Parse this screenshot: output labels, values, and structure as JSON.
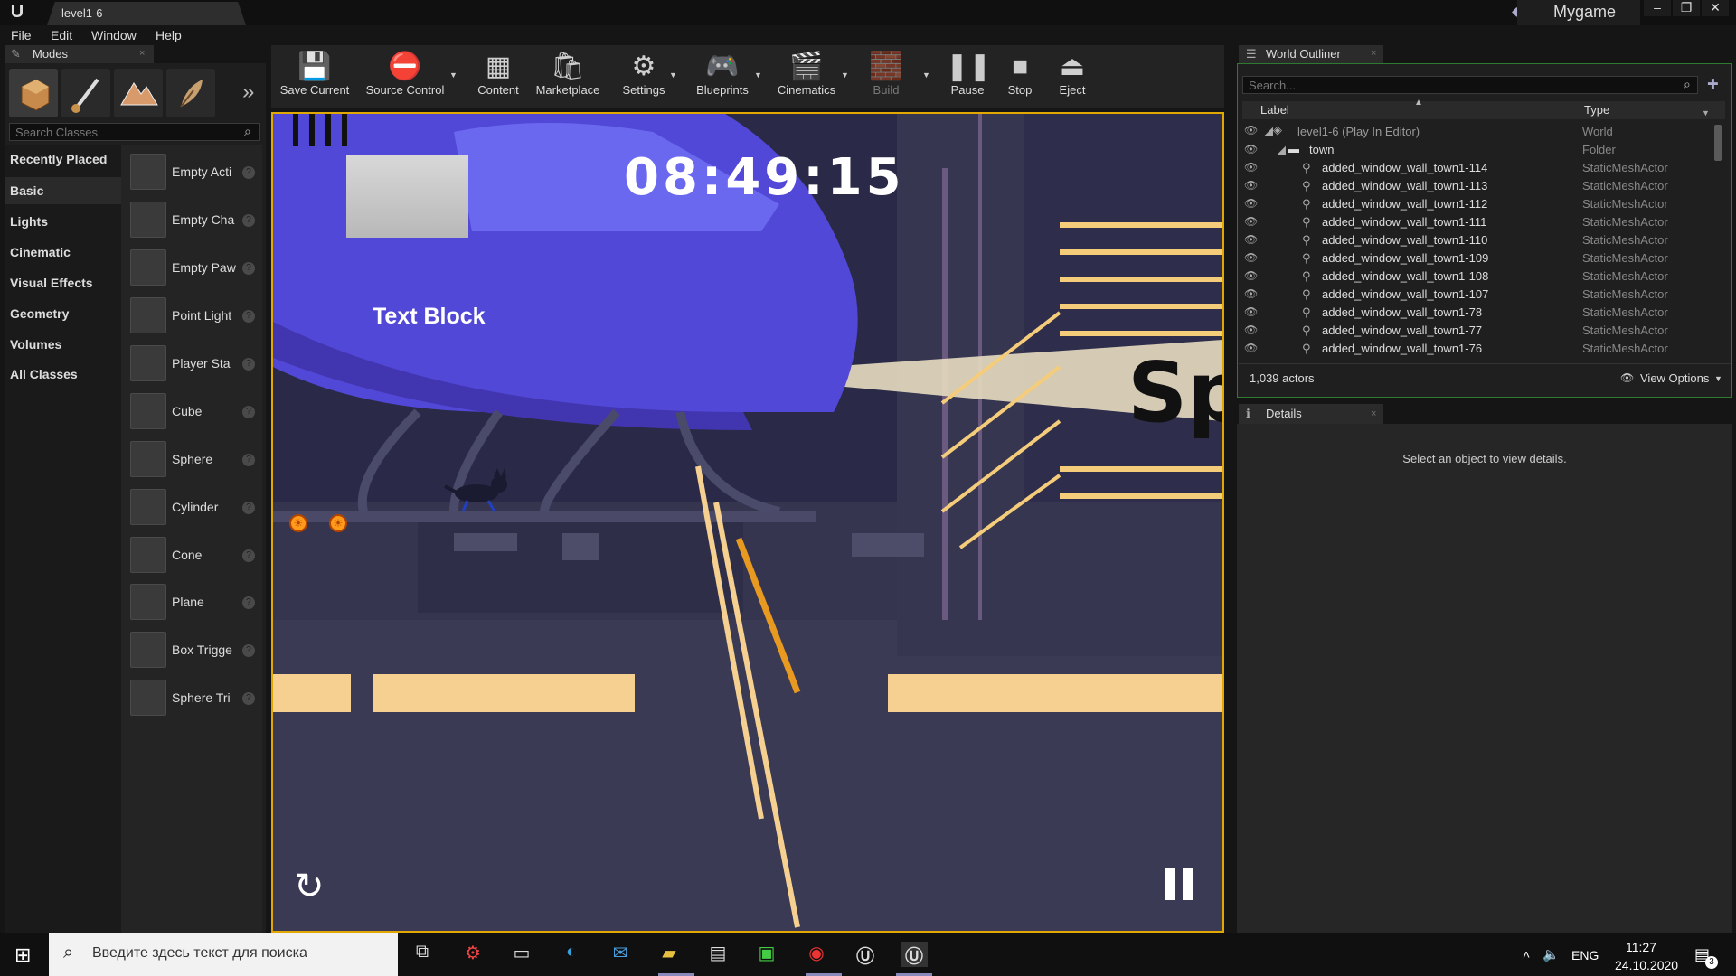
{
  "window": {
    "tab_title": "level1-6",
    "project_name": "Mygame"
  },
  "menu": [
    "File",
    "Edit",
    "Window",
    "Help"
  ],
  "modes": {
    "tab_label": "Modes",
    "search_placeholder": "Search Classes",
    "categories": [
      "Recently Placed",
      "Basic",
      "Lights",
      "Cinematic",
      "Visual Effects",
      "Geometry",
      "Volumes",
      "All Classes"
    ],
    "active_category": "Basic",
    "items": [
      "Empty Acti",
      "Empty Cha",
      "Empty Paw",
      "Point Light",
      "Player Sta",
      "Cube",
      "Sphere",
      "Cylinder",
      "Cone",
      "Plane",
      "Box Trigge",
      "Sphere Tri"
    ]
  },
  "toolbar": {
    "buttons": [
      {
        "label": "Save Current",
        "icon": "save-icon"
      },
      {
        "label": "Source Control",
        "icon": "source-control-icon"
      },
      {
        "label": "Content",
        "icon": "content-icon"
      },
      {
        "label": "Marketplace",
        "icon": "marketplace-icon"
      },
      {
        "label": "Settings",
        "icon": "settings-icon"
      },
      {
        "label": "Blueprints",
        "icon": "blueprints-icon"
      },
      {
        "label": "Cinematics",
        "icon": "cinematics-icon"
      },
      {
        "label": "Build",
        "icon": "build-icon"
      },
      {
        "label": "Pause",
        "icon": "pause-icon"
      },
      {
        "label": "Stop",
        "icon": "stop-icon"
      },
      {
        "label": "Eject",
        "icon": "eject-icon"
      }
    ]
  },
  "viewport": {
    "timer": "08:49:15",
    "text_block": "Text Block",
    "sign_text": "Spring"
  },
  "outliner": {
    "tab_label": "World Outliner",
    "search_placeholder": "Search...",
    "col_label": "Label",
    "col_type": "Type",
    "rows": [
      {
        "name": "level1-6 (Play In Editor)",
        "type": "World"
      },
      {
        "name": "town",
        "type": "Folder"
      },
      {
        "name": "added_window_wall_town1-114",
        "type": "StaticMeshActor"
      },
      {
        "name": "added_window_wall_town1-113",
        "type": "StaticMeshActor"
      },
      {
        "name": "added_window_wall_town1-112",
        "type": "StaticMeshActor"
      },
      {
        "name": "added_window_wall_town1-111",
        "type": "StaticMeshActor"
      },
      {
        "name": "added_window_wall_town1-110",
        "type": "StaticMeshActor"
      },
      {
        "name": "added_window_wall_town1-109",
        "type": "StaticMeshActor"
      },
      {
        "name": "added_window_wall_town1-108",
        "type": "StaticMeshActor"
      },
      {
        "name": "added_window_wall_town1-107",
        "type": "StaticMeshActor"
      },
      {
        "name": "added_window_wall_town1-78",
        "type": "StaticMeshActor"
      },
      {
        "name": "added_window_wall_town1-77",
        "type": "StaticMeshActor"
      },
      {
        "name": "added_window_wall_town1-76",
        "type": "StaticMeshActor"
      }
    ],
    "actor_count": "1,039 actors",
    "view_options": "View Options"
  },
  "details": {
    "tab_label": "Details",
    "empty_text": "Select an object to view details."
  },
  "taskbar": {
    "search_placeholder": "Введите здесь текст для поиска",
    "lang": "ENG",
    "time": "11:27",
    "date": "24.10.2020",
    "notification_count": "3"
  }
}
